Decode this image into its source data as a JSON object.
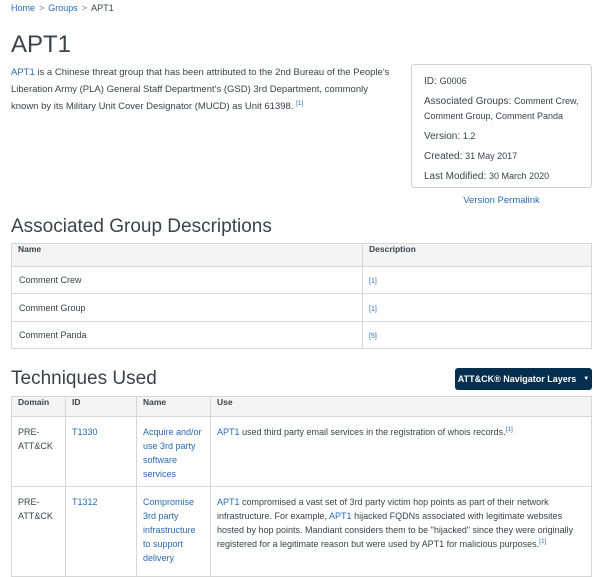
{
  "breadcrumb": {
    "home": "Home",
    "sep1": ">",
    "groups": "Groups",
    "sep2": ">",
    "current": "APT1"
  },
  "title": "APT1",
  "intro": {
    "link": "APT1",
    "text": " is a Chinese threat group that has been attributed to the 2nd Bureau of the People's Liberation Army (PLA) General Staff Department's (GSD) 3rd Department, commonly known by its Military Unit Cover Designator (MUCD) as Unit 61398. ",
    "ref": "[1]"
  },
  "card": {
    "id_label": "ID:",
    "id_value": "G0006",
    "assoc_label": "Associated Groups:",
    "assoc_value": "Comment Crew, Comment Group, Comment Panda",
    "version_label": "Version:",
    "version_value": "1.2",
    "created_label": "Created:",
    "created_value": "31 May 2017",
    "modified_label": "Last Modified:",
    "modified_value": "30 March 2020"
  },
  "permalink": "Version Permalink",
  "assoc_section": {
    "title": "Associated Group Descriptions",
    "headers": {
      "name": "Name",
      "description": "Description"
    },
    "rows": [
      {
        "name": "Comment Crew",
        "ref": "[1]"
      },
      {
        "name": "Comment Group",
        "ref": "[1]"
      },
      {
        "name": "Comment Panda",
        "ref": "[5]"
      }
    ]
  },
  "techniques": {
    "title": "Techniques Used",
    "nav_button": "ATT&CK® Navigator Layers",
    "headers": {
      "domain": "Domain",
      "id": "ID",
      "name": "Name",
      "use": "Use"
    },
    "rows": [
      {
        "domain": "PRE-ATT&CK",
        "id": "T1330",
        "name": "Acquire and/or use 3rd party software services",
        "use_link": "APT1",
        "use_text": " used third party email services in the registration of whois records.",
        "ref": "[1]"
      },
      {
        "domain": "PRE-ATT&CK",
        "id": "T1312",
        "name": "Compromise 3rd party infrastructure to support delivery",
        "use_link": "APT1",
        "use_text_1": " compromised a vast set of 3rd party victim hop points as part of their network infrastructure. For example, ",
        "use_link_2": "APT1",
        "use_text_2": " hijacked FQDNs associated with legitimate websites hosted by hop points. Mandiant considers them to be \"hijacked\" since they were originally registered for a legitimate reason but were used by APT1 for malicious purposes.",
        "ref": "[1]"
      }
    ]
  },
  "colors": {
    "link": "#2a6bb2",
    "nav_button_bg": "#062f4f",
    "text": "#39434c"
  }
}
